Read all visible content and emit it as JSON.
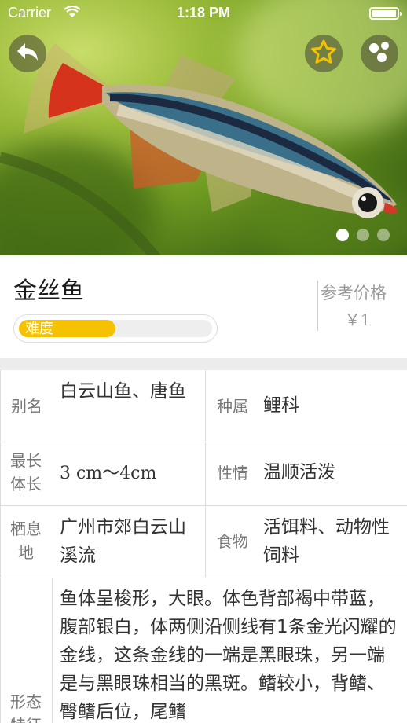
{
  "status_bar": {
    "carrier": "Carrier",
    "time": "1:18 PM"
  },
  "icons": {
    "back": "back-arrow-icon",
    "favorite": "star-icon",
    "share": "share-icon",
    "wifi": "wifi-icon",
    "battery": "battery-icon"
  },
  "carousel": {
    "count": 3,
    "active_index": 0
  },
  "fish": {
    "name": "金丝鱼",
    "difficulty_label": "难度",
    "difficulty_level": 0.5,
    "price_label": "参考价格",
    "price_value": "￥1"
  },
  "attributes": {
    "alias": {
      "label": "别名",
      "value": "白云山鱼、唐鱼"
    },
    "genus": {
      "label": "种属",
      "value": "鲤科"
    },
    "max_length": {
      "label": "最长体长",
      "value": "3 cm～4cm"
    },
    "temperament": {
      "label": "性情",
      "value": "温顺活泼"
    },
    "habitat": {
      "label": "栖息地",
      "value": "广州市郊白云山溪流"
    },
    "food": {
      "label": "食物",
      "value": "活饵料、动物性饲料"
    },
    "morphology": {
      "label": "形态特征",
      "value": "鱼体呈梭形，大眼。体色背部褐中带蓝，腹部银白，体两侧沿侧线有1条金光闪耀的金线，这条金线的一端是黑眼珠，另一端是与黑眼珠相当的黑斑。鳍较小，背鳍、臀鳍后位，尾鳍"
    }
  },
  "colors": {
    "accent_yellow": "#f6c200",
    "divider": "#dddddd",
    "label_gray": "#777777"
  }
}
